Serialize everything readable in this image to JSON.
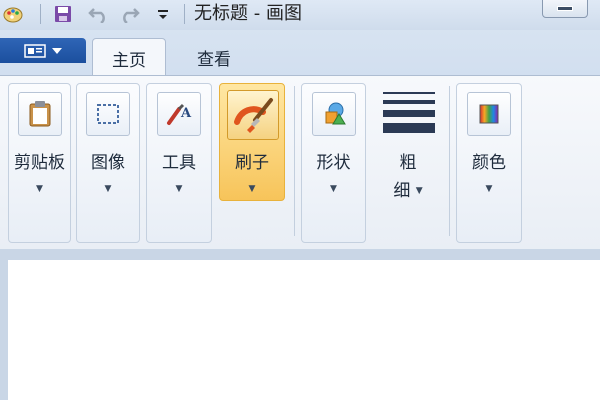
{
  "window": {
    "title": "无标题 - 画图",
    "quick_access": [
      "paint-app-icon",
      "save-icon",
      "undo-icon",
      "redo-icon",
      "customize-quick-access-icon"
    ]
  },
  "tabs": [
    {
      "label": "主页",
      "active": true
    },
    {
      "label": "查看",
      "active": false
    }
  ],
  "ribbon": {
    "groups": [
      {
        "id": "clipboard",
        "label": "剪贴板",
        "icon": "clipboard-icon",
        "has_dropdown": true
      },
      {
        "id": "image",
        "label": "图像",
        "icon": "image-select-icon",
        "has_dropdown": true
      },
      {
        "id": "tools",
        "label": "工具",
        "icon": "tools-icon",
        "has_dropdown": true
      },
      {
        "id": "brushes",
        "label": "刷子",
        "icon": "brush-icon",
        "has_dropdown": true,
        "highlighted": true
      },
      {
        "id": "shapes",
        "label": "形状",
        "icon": "shapes-icon",
        "has_dropdown": true
      },
      {
        "id": "size",
        "label_line1": "粗",
        "label_line2": "细",
        "icon": "line-size-icon",
        "has_dropdown": true
      },
      {
        "id": "colors",
        "label": "颜色",
        "icon": "color-palette-icon",
        "has_dropdown": true
      }
    ]
  },
  "colors": {
    "file_button": "#1b4f9e",
    "highlight": "#f7c45a",
    "canvas": "#ffffff",
    "workspace": "#c9d6e6"
  }
}
